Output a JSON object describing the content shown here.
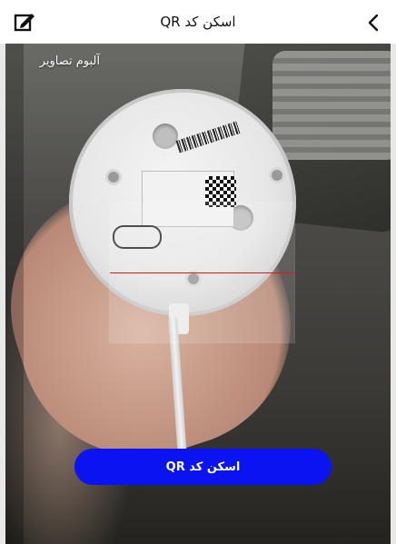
{
  "header": {
    "title": "اسکن کد QR",
    "edit_icon": "edit-square-icon",
    "back_icon": "chevron-left-icon"
  },
  "camera": {
    "gallery_label": "آلبوم تصاویر"
  },
  "scan_button_label": "اسکن کد QR",
  "colors": {
    "primary_button": "#0a14f0",
    "scan_line": "#e01818",
    "header_bg": "#ffffff"
  }
}
